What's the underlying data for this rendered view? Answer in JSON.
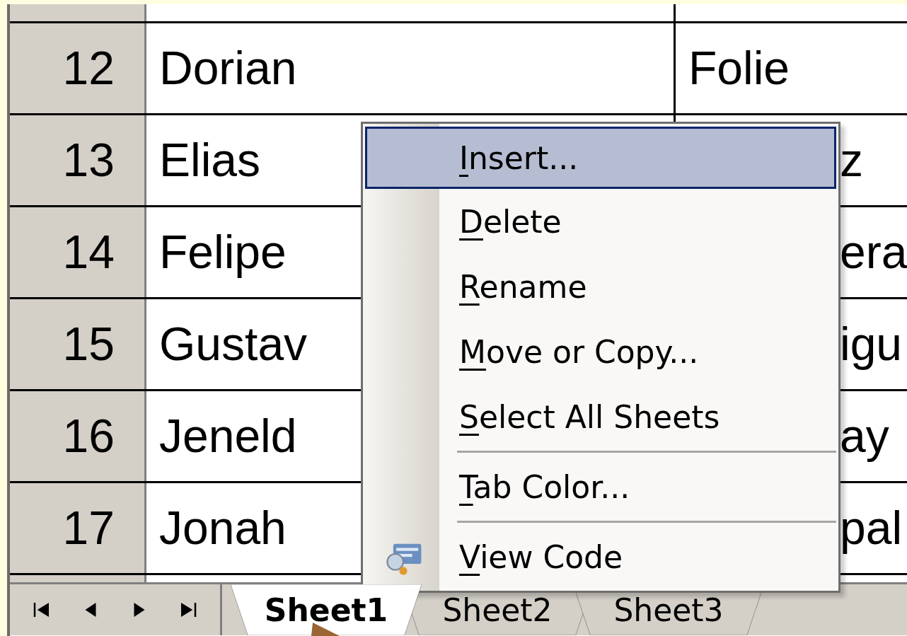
{
  "rows": [
    {
      "number": "12",
      "first": "Dorian",
      "last": "Folie"
    },
    {
      "number": "13",
      "first": "Elias",
      "last": "z"
    },
    {
      "number": "14",
      "first": "Felipe",
      "last": "era"
    },
    {
      "number": "15",
      "first": "Gustav",
      "last": "igu"
    },
    {
      "number": "16",
      "first": "Jeneld",
      "last": "ay"
    },
    {
      "number": "17",
      "first": "Jonah",
      "last": "pal"
    }
  ],
  "sheet_tabs": [
    {
      "label": "Sheet1",
      "selected": true
    },
    {
      "label": "Sheet2",
      "selected": false
    },
    {
      "label": "Sheet3",
      "selected": false
    }
  ],
  "context_menu": {
    "items": [
      {
        "kind": "item",
        "accel": "I",
        "rest": "nsert...",
        "selected": true
      },
      {
        "kind": "item",
        "accel": "D",
        "rest": "elete",
        "selected": false
      },
      {
        "kind": "item",
        "accel": "R",
        "rest": "ename",
        "selected": false
      },
      {
        "kind": "item",
        "accel": "M",
        "rest": "ove or Copy...",
        "selected": false
      },
      {
        "kind": "item",
        "accel": "S",
        "rest": "elect All Sheets",
        "selected": false
      },
      {
        "kind": "separator"
      },
      {
        "kind": "item",
        "accel": "T",
        "rest": "ab Color...",
        "selected": false
      },
      {
        "kind": "separator"
      },
      {
        "kind": "icon_item",
        "accel": "V",
        "rest": "iew Code",
        "selected": false
      }
    ]
  }
}
